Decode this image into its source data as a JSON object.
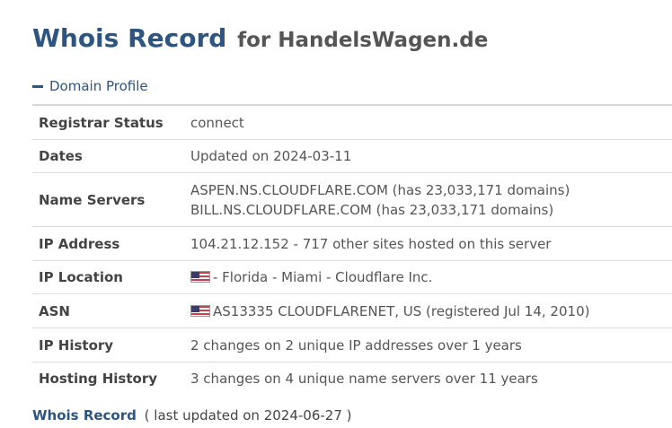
{
  "header": {
    "title": "Whois Record",
    "for_text": "for HandelsWagen.de"
  },
  "section": {
    "label": "Domain Profile"
  },
  "profile": {
    "registrar_status": {
      "label": "Registrar Status",
      "value": "connect"
    },
    "dates": {
      "label": "Dates",
      "value": "Updated on 2024-03-11"
    },
    "name_servers": {
      "label": "Name Servers",
      "values": [
        "ASPEN.NS.CLOUDFLARE.COM (has 23,033,171 domains)",
        "BILL.NS.CLOUDFLARE.COM (has 23,033,171 domains)"
      ]
    },
    "ip_address": {
      "label": "IP Address",
      "value": "104.21.12.152 - 717 other sites hosted on this server"
    },
    "ip_location": {
      "label": "IP Location",
      "flag": "us-flag-icon",
      "value": "- Florida - Miami - Cloudflare Inc."
    },
    "asn": {
      "label": "ASN",
      "flag": "us-flag-icon",
      "value": "AS13335 CLOUDFLARENET, US (registered Jul 14, 2010)"
    },
    "ip_history": {
      "label": "IP History",
      "value": "2 changes on 2 unique IP addresses over 1 years"
    },
    "hosting_history": {
      "label": "Hosting History",
      "value": "3 changes on 4 unique name servers over 11 years"
    }
  },
  "footer": {
    "link": "Whois Record",
    "note": "( last updated on 2024-06-27 )"
  },
  "colors": {
    "accent": "#2e5580",
    "text": "#444444",
    "border": "#dcdcdc"
  }
}
